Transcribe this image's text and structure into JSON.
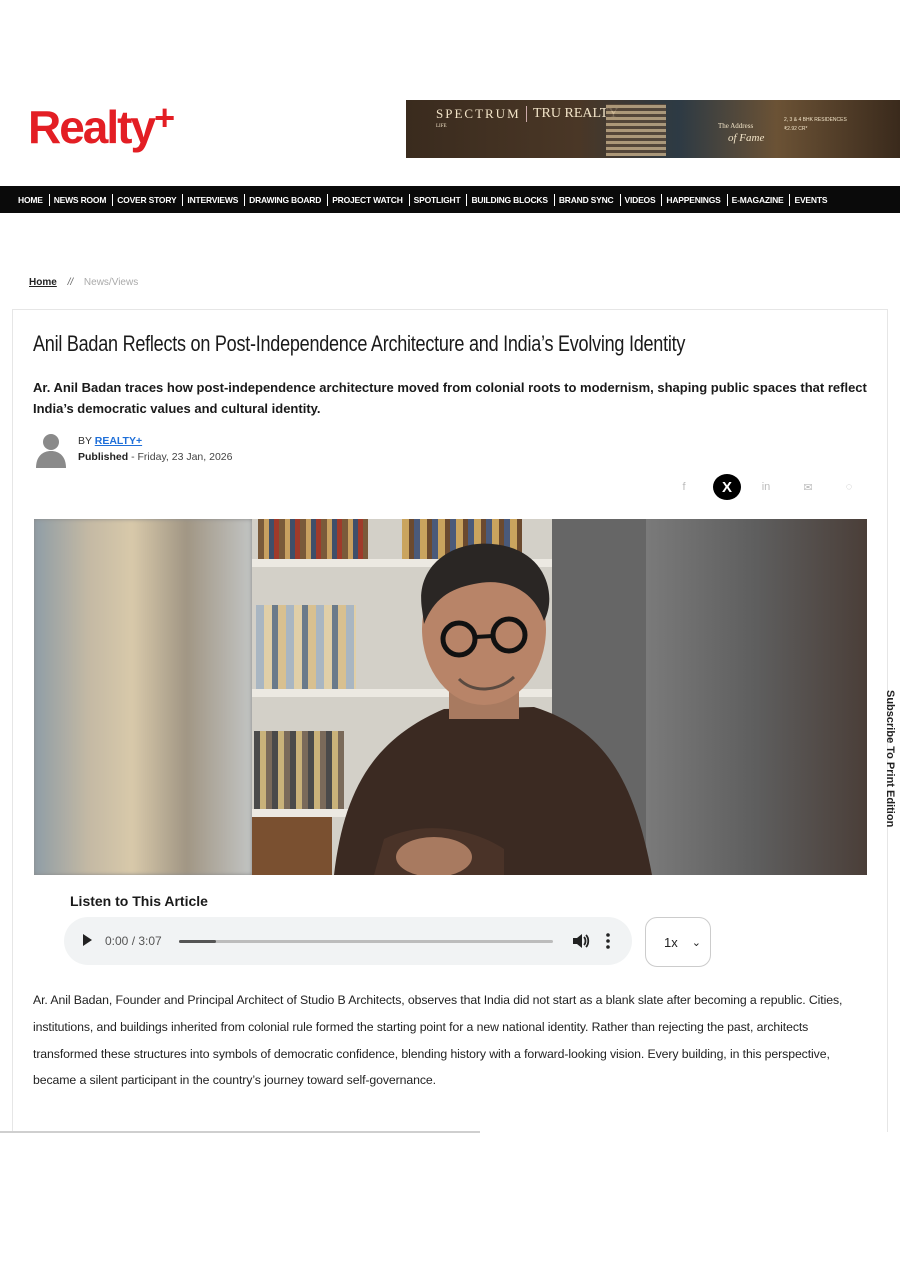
{
  "brand": {
    "logo_text": "Realty",
    "logo_plus": "+"
  },
  "ad_banner": {
    "brand": "SPECTRUM",
    "brand_sub": "LIFE",
    "developer": "TRU REALTY",
    "tagline_1": "The Address",
    "tagline_2": "of Fame",
    "residences": "2, 3 & 4 BHK RESIDENCES",
    "price": "₹2.92 CR*"
  },
  "nav": {
    "items": [
      "HOME",
      "NEWS ROOM",
      "COVER STORY",
      "INTERVIEWS",
      "DRAWING BOARD",
      "PROJECT WATCH",
      "SPOTLIGHT",
      "BUILDING BLOCKS",
      "BRAND SYNC",
      "VIDEOS",
      "HAPPENINGS",
      "E-MAGAZINE",
      "EVENTS"
    ]
  },
  "breadcrumb": {
    "home": "Home",
    "separator": "//",
    "current": "News/Views"
  },
  "article": {
    "title": "Anil Badan Reflects on Post-Independence Architecture and India’s Evolving Identity",
    "subtitle": "Ar. Anil Badan traces how post-independence architecture moved from colonial roots to modernism, shaping public spaces that reflect India’s democratic values and cultural identity.",
    "by_prefix": "BY",
    "author": "REALTY+",
    "published_label": "Published",
    "published_date": " - Friday, 23 Jan, 2026",
    "body": "Ar. Anil Badan, Founder and Principal Architect of Studio B Architects, observes that India did not start as a blank slate after becoming a republic. Cities, institutions, and buildings inherited from colonial rule formed the starting point for a new national identity. Rather than rejecting the past, architects transformed these structures into symbols of democratic confidence, blending history with a forward-looking vision. Every building, in this perspective, became a silent participant in the country’s journey toward self-governance."
  },
  "share": {
    "facebook": "f",
    "x": "X",
    "linkedin": "in",
    "email": "✉",
    "whatsapp": "◌"
  },
  "audio": {
    "heading": "Listen to This Article",
    "time": "0:00 / 3:07",
    "progress": 0.1,
    "speed": "1x"
  },
  "side_tab": {
    "label": "Subscribe To Print Edition"
  },
  "colors": {
    "brand_red": "#e31e24",
    "nav_bg": "#0a0a0a",
    "link_blue": "#1e6fd9"
  }
}
